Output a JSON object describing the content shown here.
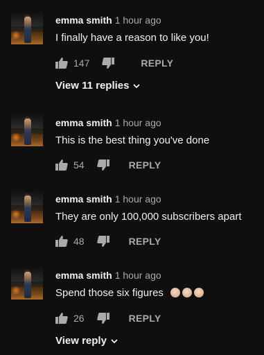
{
  "comments": [
    {
      "author": "emma smith",
      "time": "1 hour ago",
      "text": "I finally have a reason to like you!",
      "likes": "147",
      "reply_label": "REPLY",
      "view_replies": "View 11 replies"
    },
    {
      "author": "emma smith",
      "time": "1 hour ago",
      "text": "This is the best thing you've done",
      "likes": "54",
      "reply_label": "REPLY"
    },
    {
      "author": "emma smith",
      "time": "1 hour ago",
      "text": "They are only 100,000 subscribers apart",
      "likes": "48",
      "reply_label": "REPLY"
    },
    {
      "author": "emma smith",
      "time": "1 hour ago",
      "text": "Spend those six figures",
      "emojis": [
        "clapping-hands-icon",
        "clapping-hands-icon",
        "clapping-hands-icon"
      ],
      "likes": "26",
      "reply_label": "REPLY",
      "view_replies": "View reply"
    }
  ],
  "colors": {
    "background": "#0f0f0f",
    "primary_text": "#f1f1f1",
    "secondary_text": "#aaaaaa"
  }
}
